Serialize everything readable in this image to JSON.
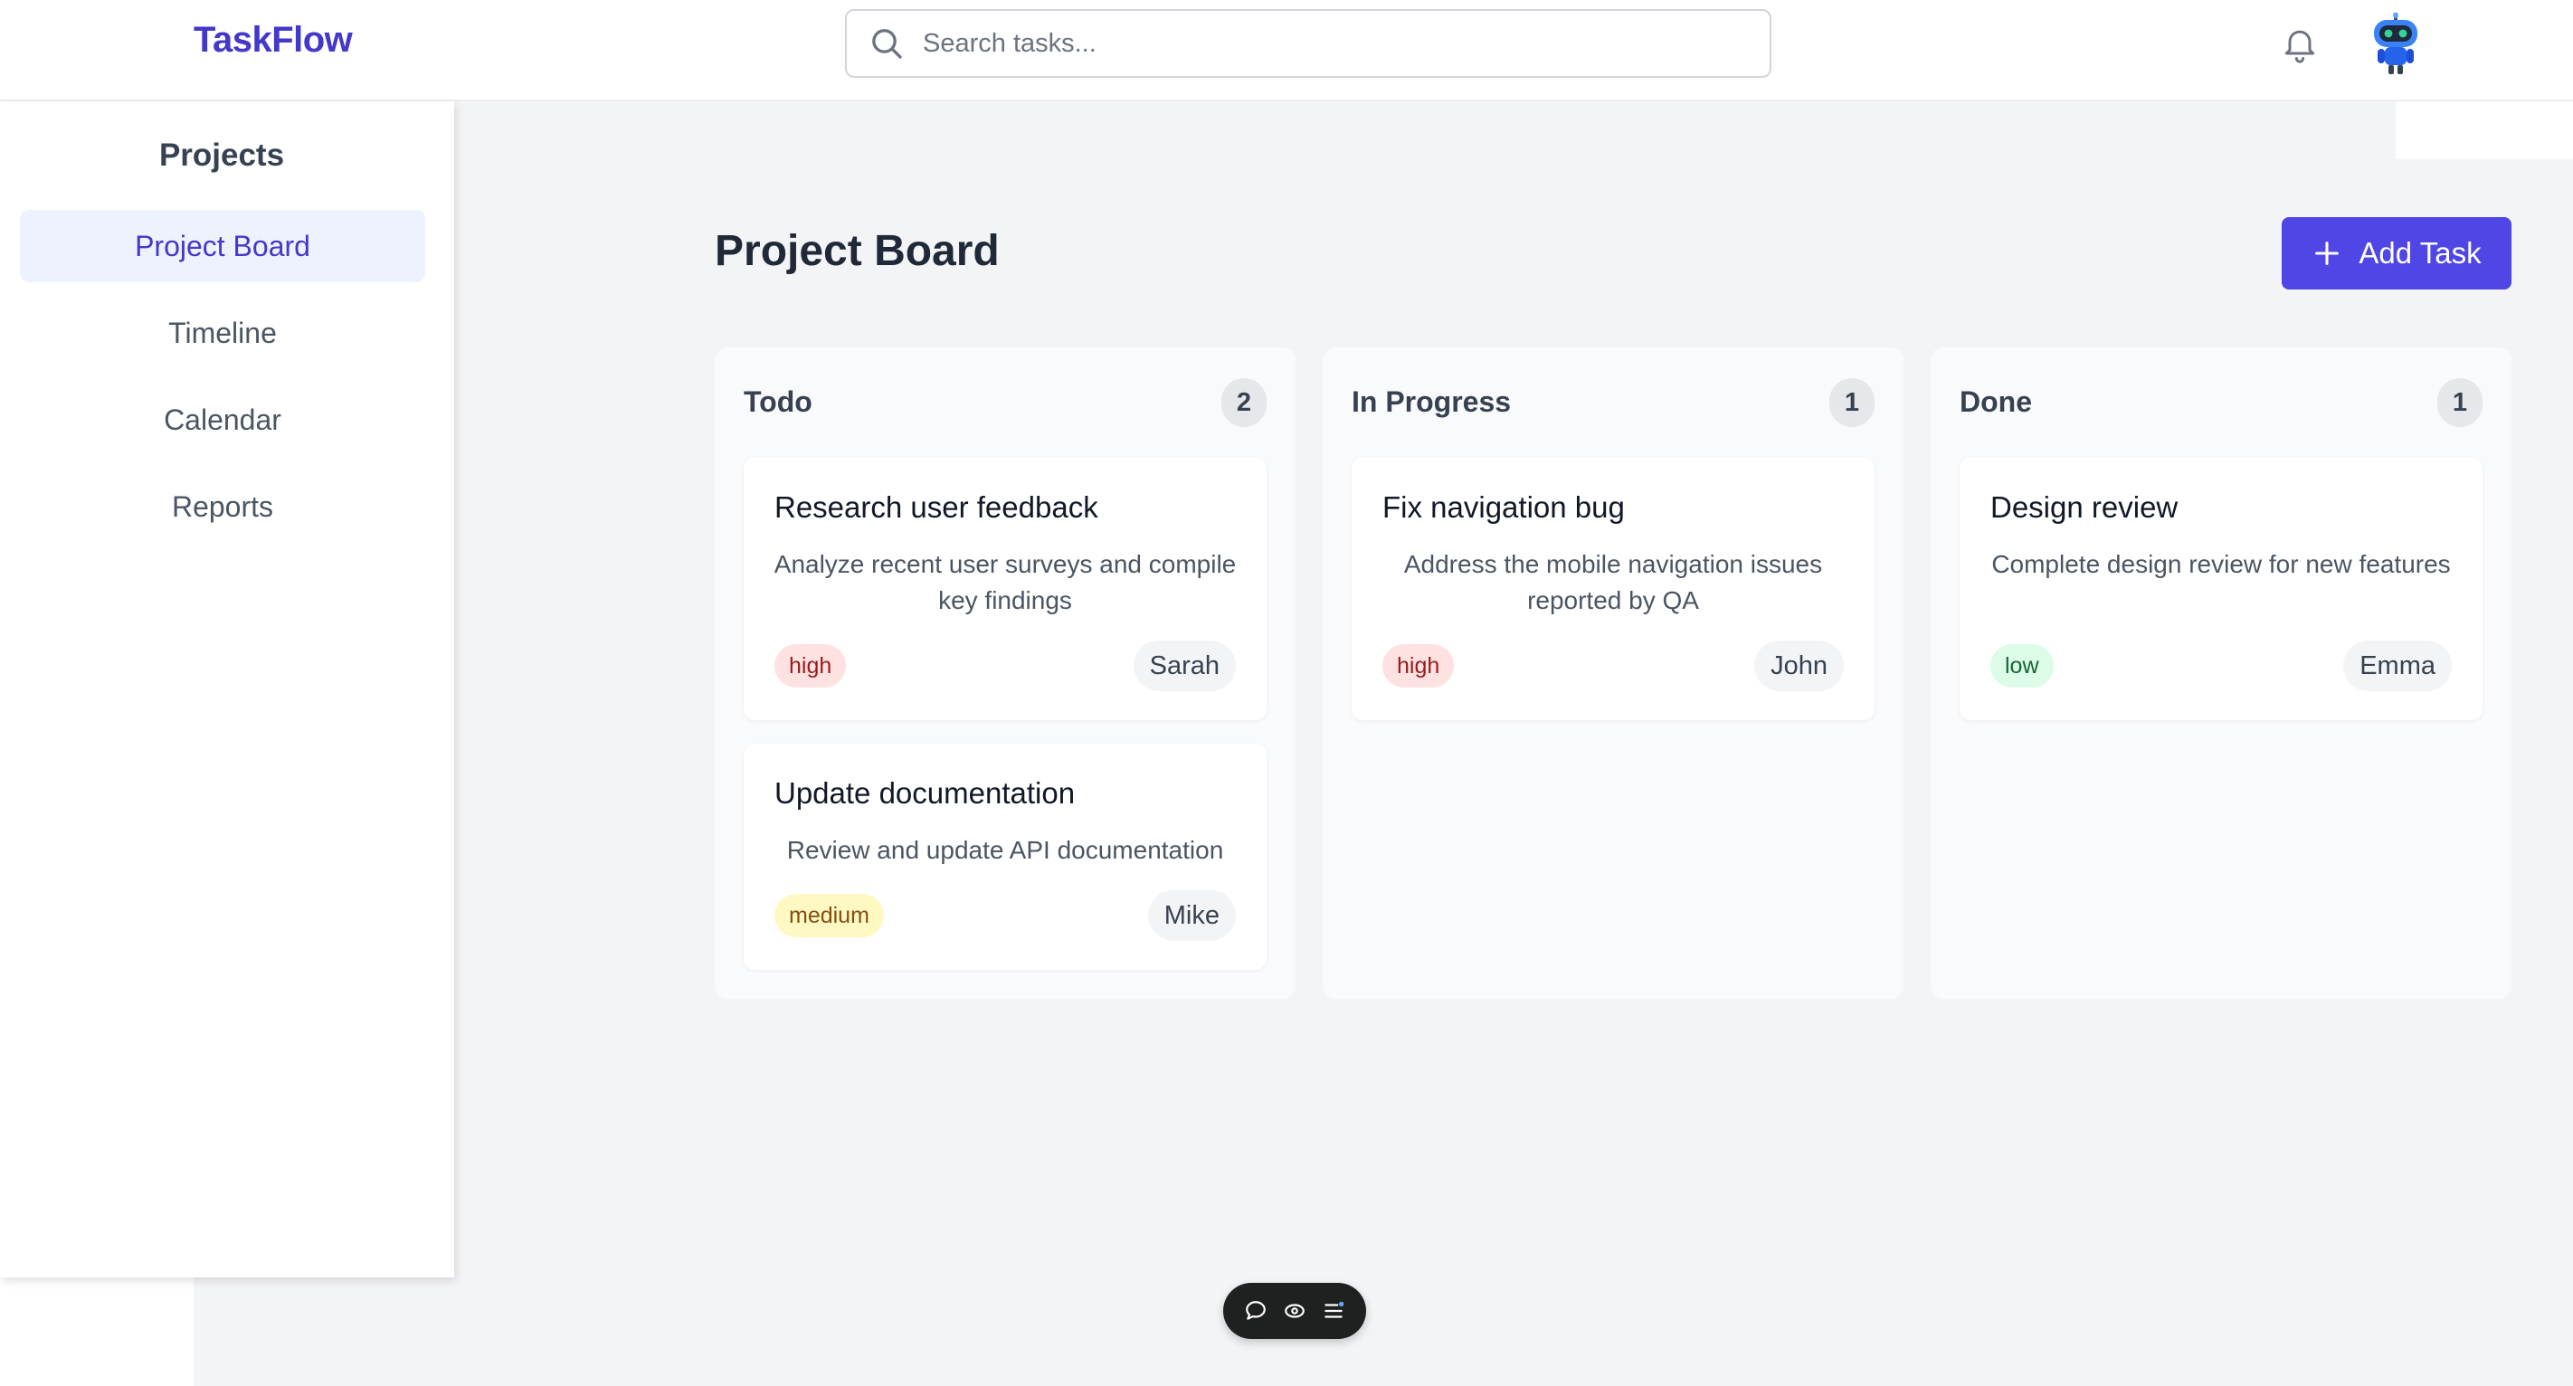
{
  "header": {
    "logo": "TaskFlow",
    "search_placeholder": "Search tasks...",
    "icons": [
      "search-icon",
      "bell-icon",
      "robot-avatar-icon"
    ]
  },
  "sidebar": {
    "title": "Projects",
    "items": [
      {
        "label": "Project Board",
        "active": true
      },
      {
        "label": "Timeline",
        "active": false
      },
      {
        "label": "Calendar",
        "active": false
      },
      {
        "label": "Reports",
        "active": false
      }
    ]
  },
  "board": {
    "title": "Project Board",
    "add_label": "Add Task",
    "columns": [
      {
        "title": "Todo",
        "count": "2",
        "cards": [
          {
            "title": "Research user feedback",
            "description": "Analyze recent user surveys and compile key findings",
            "priority": "high",
            "assignee": "Sarah"
          },
          {
            "title": "Update documentation",
            "description": "Review and update API documentation",
            "priority": "medium",
            "assignee": "Mike"
          }
        ]
      },
      {
        "title": "In Progress",
        "count": "1",
        "cards": [
          {
            "title": "Fix navigation bug",
            "description": "Address the mobile navigation issues reported by QA",
            "priority": "high",
            "assignee": "John"
          }
        ]
      },
      {
        "title": "Done",
        "count": "1",
        "cards": [
          {
            "title": "Design review",
            "description": "Complete design review for new features",
            "priority": "low",
            "assignee": "Emma"
          }
        ]
      }
    ]
  },
  "float_toolbar": {
    "icons": [
      "comment-icon",
      "eye-icon",
      "menu-icon"
    ]
  },
  "colors": {
    "brand": "#4338ca",
    "primary_button": "#4f46e5",
    "active_nav_bg": "#eef2ff",
    "priority_high": "#fee2e2",
    "priority_medium": "#fef9c3",
    "priority_low": "#dcfce7"
  }
}
